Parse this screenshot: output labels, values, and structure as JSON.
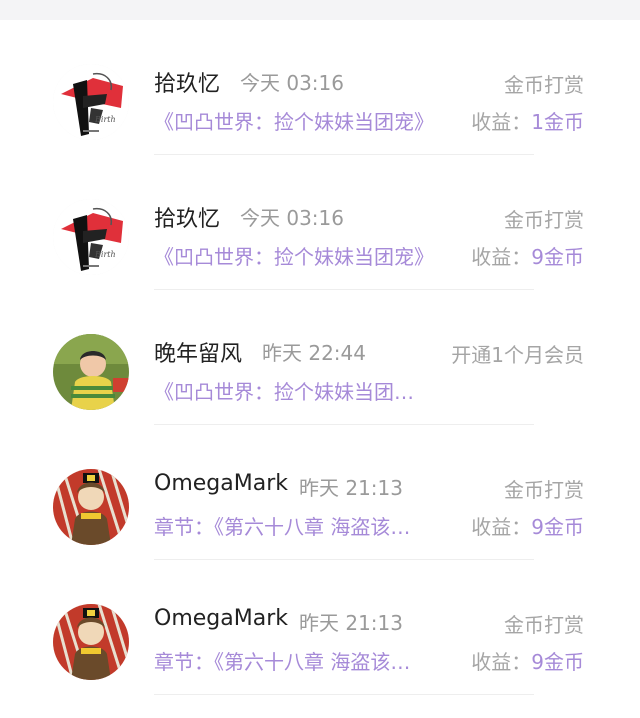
{
  "items": [
    {
      "name": "拾玖忆",
      "time": "今天 03:16",
      "kind": "金币打赏",
      "detail": "《凹凸世界：捡个妹妹当团宠》",
      "income_label": "收益：",
      "income_value": "1金币",
      "avatar": "ink-art-avatar"
    },
    {
      "name": "拾玖忆",
      "time": "今天 03:16",
      "kind": "金币打赏",
      "detail": "《凹凸世界：捡个妹妹当团宠》",
      "income_label": "收益：",
      "income_value": "9金币",
      "avatar": "ink-art-avatar"
    },
    {
      "name": "晚年留风",
      "time": "昨天 22:44",
      "kind": "开通1个月会员",
      "detail": "《凹凸世界：捡个妹妹当团…",
      "income_label": "",
      "income_value": "",
      "avatar": "child-photo-avatar"
    },
    {
      "name": "OmegaMark",
      "time": "昨天 21:13",
      "kind": "金币打赏",
      "detail": "章节：《第六十八章 海盗该…",
      "income_label": "收益：",
      "income_value": "9金币",
      "avatar": "anime-character-avatar"
    },
    {
      "name": "OmegaMark",
      "time": "昨天 21:13",
      "kind": "金币打赏",
      "detail": "章节：《第六十八章 海盗该…",
      "income_label": "收益：",
      "income_value": "9金币",
      "avatar": "anime-character-avatar"
    }
  ],
  "colors": {
    "accent": "#a68ad8",
    "secondary_text": "#a5a5a5",
    "primary_text": "#222222"
  }
}
